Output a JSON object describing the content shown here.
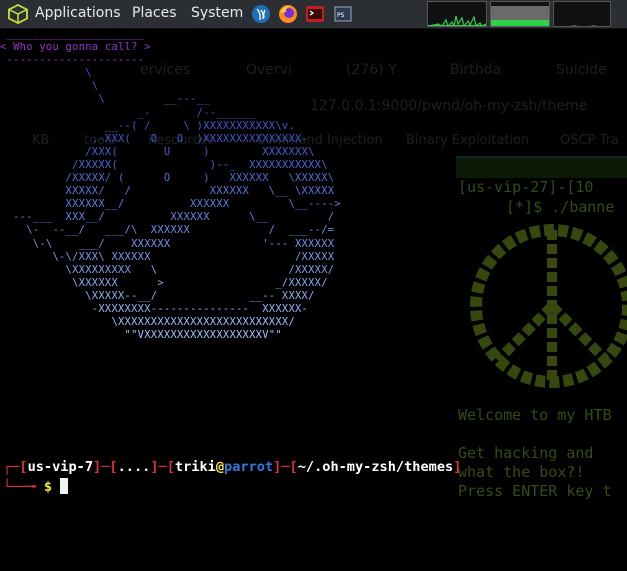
{
  "panel": {
    "menus": [
      "Applications",
      "Places",
      "System"
    ]
  },
  "ghost": {
    "tabs": [
      "ervices",
      "Overvi",
      "(276) Y",
      "Birthda",
      "Suicide"
    ],
    "url": "127.0.0.1:9000/pwnd/oh-my-zsh/theme",
    "bookmarks": [
      "KB",
      "tools",
      "Resources",
      "Command Injection",
      "Binary Exploitation",
      "OSCP Tra"
    ]
  },
  "term2": {
    "lines": [
      "[us-vip-27]-[10",
      "[*]$ ./banne",
      "Welcome to my HTB",
      "Get hacking and",
      "what the box?!",
      "Press ENTER key t"
    ]
  },
  "ascii": {
    "lines": [
      " _____________________",
      "< Who you gonna call? >",
      " ---------------------",
      "             \\",
      "              \\",
      "               \\         __---__",
      "                     _-       /--______",
      "                __--( /     \\ )XXXXXXXXXXX\\v.",
      "              .-XXX(   O   O  )XXXXXXXXXXXXXXX-",
      "             /XXX(       U     )        XXXXXXX\\",
      "           /XXXXX(              )--_  XXXXXXXXXXX\\",
      "          /XXXXX/ (      O     )   XXXXXX   \\XXXXX\\",
      "          XXXXX/   /            XXXXXX   \\__ \\XXXXX",
      "          XXXXXX__/          XXXXXX         \\__---->",
      "  ---___  XXX__/          XXXXXX      \\__         /",
      "    \\-  --__/   ___/\\  XXXXXX            /  ___--/=",
      "     \\-\\    ___/    XXXXXX              '--- XXXXXX",
      "        \\-\\/XXX\\ XXXXXX                      /XXXXX",
      "          \\XXXXXXXXX   \\                    /XXXXX/",
      "           \\XXXXXX      >                 _/XXXXX/",
      "             \\XXXXX--__/              __-- XXXX/",
      "              -XXXXXXXX---------------  XXXXXX-",
      "                 \\XXXXXXXXXXXXXXXXXXXXXXXXXX/",
      "                   \"\"VXXXXXXXXXXXXXXXXXXV\"\""
    ]
  },
  "prompt": {
    "host": "us-vip-7",
    "dots": "....",
    "user": "triki",
    "machine": "parrot",
    "path": "~/.oh-my-zsh/themes",
    "symbol": "$"
  },
  "colors": {
    "ascii_top": "#a030c8",
    "ascii_mid": "#3a5bd0",
    "ascii_bottom": "#9fc7ff",
    "prompt_red": "#e0313b",
    "term2_green": "#5f8b1f"
  }
}
